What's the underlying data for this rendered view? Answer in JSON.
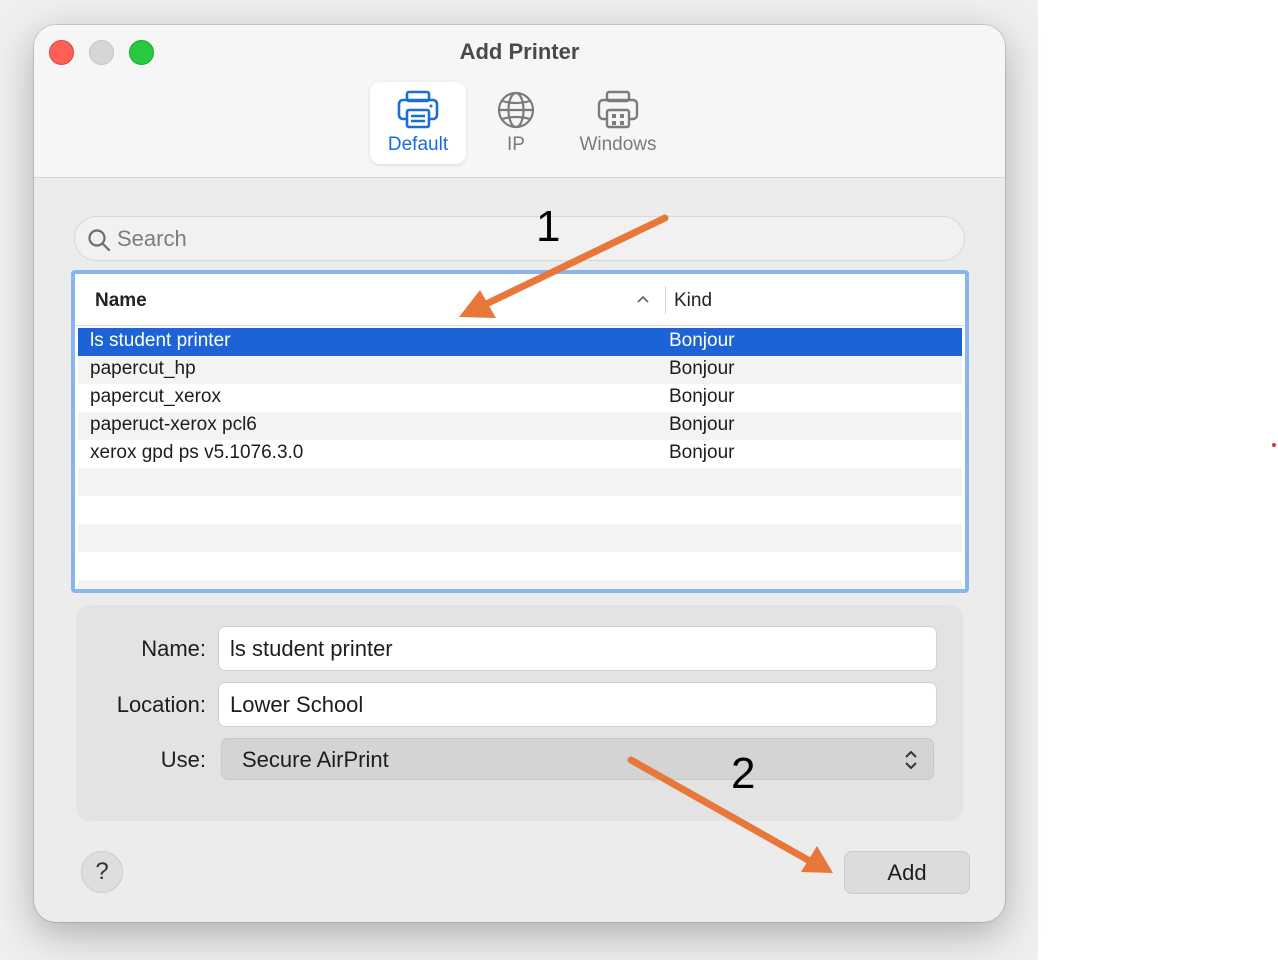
{
  "window": {
    "title": "Add Printer"
  },
  "tabs": [
    {
      "label": "Default",
      "icon": "printer-icon",
      "active": true
    },
    {
      "label": "IP",
      "icon": "globe-icon",
      "active": false
    },
    {
      "label": "Windows",
      "icon": "printer-windows-icon",
      "active": false
    }
  ],
  "search": {
    "placeholder": "Search",
    "value": ""
  },
  "list": {
    "columns": {
      "name": "Name",
      "kind": "Kind"
    },
    "rows": [
      {
        "name": "ls student printer",
        "kind": "Bonjour",
        "selected": true
      },
      {
        "name": "papercut_hp",
        "kind": "Bonjour",
        "selected": false
      },
      {
        "name": "papercut_xerox",
        "kind": "Bonjour",
        "selected": false
      },
      {
        "name": "paperuct-xerox pcl6",
        "kind": "Bonjour",
        "selected": false
      },
      {
        "name": "xerox gpd ps v5.1076.3.0",
        "kind": "Bonjour",
        "selected": false
      }
    ]
  },
  "details": {
    "name_label": "Name:",
    "name_value": "ls student printer",
    "location_label": "Location:",
    "location_value": "Lower School",
    "use_label": "Use:",
    "use_value": "Secure AirPrint"
  },
  "footer": {
    "help_label": "?",
    "add_label": "Add"
  },
  "annotations": {
    "step1": "1",
    "step2": "2",
    "arrow_color": "#e8773a"
  },
  "colors": {
    "accent": "#1a6dd9",
    "selection": "#1b63d6",
    "list_focus_ring": "#8ab4f0"
  }
}
